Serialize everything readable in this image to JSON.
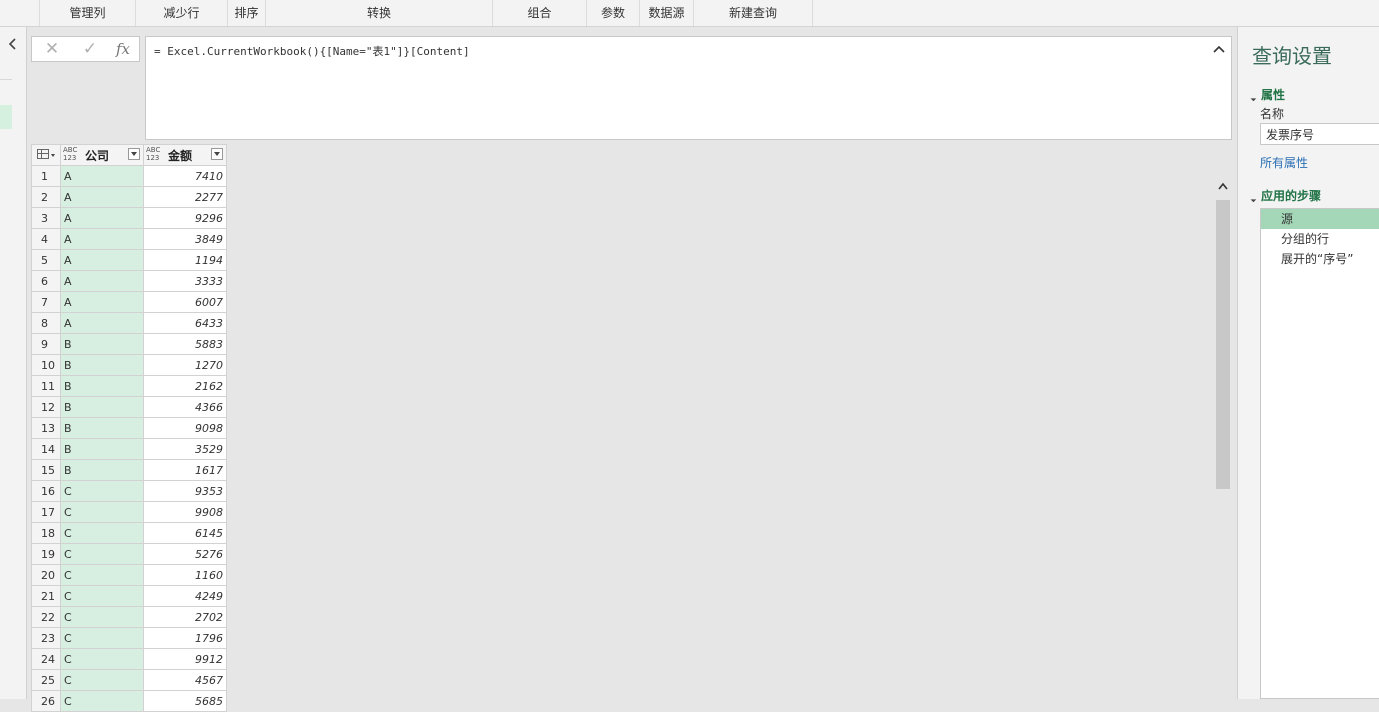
{
  "ribbon": {
    "groups": [
      "管理列",
      "减少行",
      "排序",
      "转换",
      "组合",
      "参数",
      "数据源",
      "新建查询"
    ]
  },
  "formula": {
    "cancel_icon": "close-icon",
    "confirm_icon": "check-icon",
    "fx_label": "fx",
    "text": "= Excel.CurrentWorkbook(){[Name=\"表1\"]}[Content]"
  },
  "grid": {
    "type_icon_top": "ABC",
    "type_icon_bottom": "123",
    "columns": [
      "公司",
      "金额"
    ],
    "rows": [
      {
        "n": "1",
        "company": "A",
        "amount": "7410"
      },
      {
        "n": "2",
        "company": "A",
        "amount": "2277"
      },
      {
        "n": "3",
        "company": "A",
        "amount": "9296"
      },
      {
        "n": "4",
        "company": "A",
        "amount": "3849"
      },
      {
        "n": "5",
        "company": "A",
        "amount": "1194"
      },
      {
        "n": "6",
        "company": "A",
        "amount": "3333"
      },
      {
        "n": "7",
        "company": "A",
        "amount": "6007"
      },
      {
        "n": "8",
        "company": "A",
        "amount": "6433"
      },
      {
        "n": "9",
        "company": "B",
        "amount": "5883"
      },
      {
        "n": "10",
        "company": "B",
        "amount": "1270"
      },
      {
        "n": "11",
        "company": "B",
        "amount": "2162"
      },
      {
        "n": "12",
        "company": "B",
        "amount": "4366"
      },
      {
        "n": "13",
        "company": "B",
        "amount": "9098"
      },
      {
        "n": "14",
        "company": "B",
        "amount": "3529"
      },
      {
        "n": "15",
        "company": "B",
        "amount": "1617"
      },
      {
        "n": "16",
        "company": "C",
        "amount": "9353"
      },
      {
        "n": "17",
        "company": "C",
        "amount": "9908"
      },
      {
        "n": "18",
        "company": "C",
        "amount": "6145"
      },
      {
        "n": "19",
        "company": "C",
        "amount": "5276"
      },
      {
        "n": "20",
        "company": "C",
        "amount": "1160"
      },
      {
        "n": "21",
        "company": "C",
        "amount": "4249"
      },
      {
        "n": "22",
        "company": "C",
        "amount": "2702"
      },
      {
        "n": "23",
        "company": "C",
        "amount": "1796"
      },
      {
        "n": "24",
        "company": "C",
        "amount": "9912"
      },
      {
        "n": "25",
        "company": "C",
        "amount": "4567"
      },
      {
        "n": "26",
        "company": "C",
        "amount": "5685"
      }
    ]
  },
  "settings": {
    "title": "查询设置",
    "properties_header": "属性",
    "name_label": "名称",
    "name_value": "发票序号",
    "all_properties": "所有属性",
    "steps_header": "应用的步骤",
    "steps": [
      "源",
      "分组的行",
      "展开的“序号”"
    ],
    "selected_step": 0
  },
  "colors": {
    "accent": "#217346",
    "selected_column": "#d7efe1",
    "selected_step": "#a3d7b7"
  }
}
